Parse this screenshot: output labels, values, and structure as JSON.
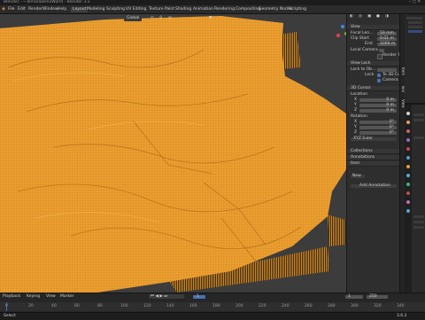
{
  "window": {
    "title": "Blender - ~TerrainDemoWorld - Blender 3.x"
  },
  "menu": {
    "items": [
      "File",
      "Edit",
      "Render",
      "Window",
      "Help",
      "Layout",
      "Modeling",
      "Sculpting",
      "UV Editing",
      "Texture Paint",
      "Shading",
      "Animation",
      "Rendering",
      "Compositing",
      "Geometry Nodes",
      "Scripting"
    ],
    "active_workspace": "Layout"
  },
  "viewport": {
    "mode": "Global",
    "terrain_color": "#e89b2e",
    "background_color": "#3c3c3c"
  },
  "npanel": {
    "sections": {
      "view": "View",
      "view_lock": "View Lock",
      "cursor": "3D Cursor",
      "collections": "Collections",
      "annotations": "Annotations",
      "item": "Item"
    },
    "fields": {
      "focal_length": "Focal Len...",
      "focal_value": "50 mm",
      "clip_start": "Clip Start",
      "clip_start_value": "0.01 m",
      "clip_end": "End",
      "clip_end_value": "1000 m",
      "local_camera": "Local Camera",
      "render_region": "Render Reg...",
      "lock_to_object": "Lock to Ob...",
      "lock": "Lock",
      "to_cursor": "To 3D Cursor",
      "camera_to_view": "Camera to V...",
      "location": "Location",
      "x": "X",
      "y": "Y",
      "z": "Z",
      "x_val": "0 m",
      "y_val": "0 m",
      "z_val": "0 m",
      "rotation": "Rotation",
      "rx_val": "0°",
      "ry_val": "0°",
      "rz_val": "0°",
      "rotation_mode": "XYZ Euler",
      "new_layer": "New",
      "add_annotation": "Add Annotation"
    },
    "tabs": [
      "Item",
      "Tool",
      "View"
    ]
  },
  "timeline": {
    "frame_labels": [
      "0",
      "20",
      "40",
      "60",
      "80",
      "100",
      "120",
      "140",
      "160",
      "180",
      "200",
      "220",
      "240",
      "260",
      "280",
      "300",
      "320",
      "340"
    ],
    "current_frame": "1",
    "start": "1",
    "end": "250",
    "playback": "Playback",
    "keying": "Keying",
    "view": "View",
    "marker": "Marker"
  },
  "status": {
    "text": "Select",
    "version": "3.6.2"
  }
}
